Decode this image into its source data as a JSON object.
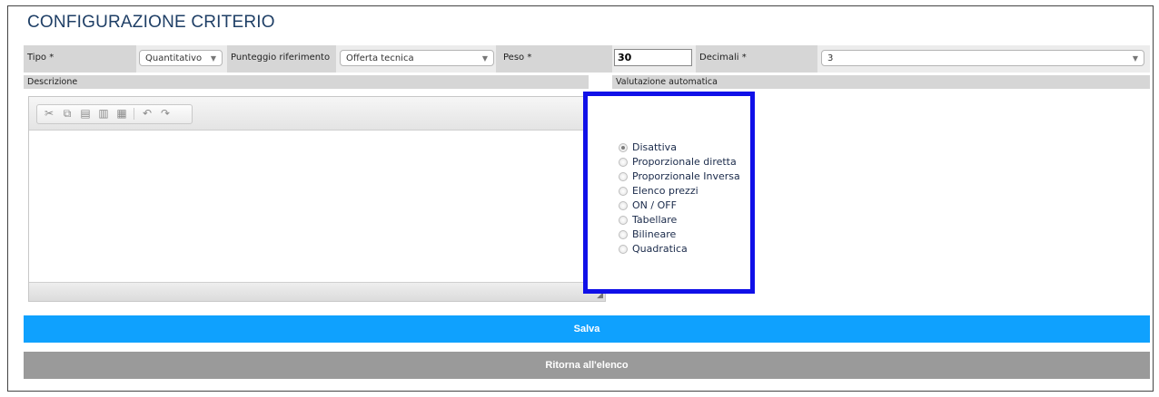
{
  "page": {
    "title": "CONFIGURAZIONE CRITERIO"
  },
  "form": {
    "tipo_label": "Tipo *",
    "tipo_value": "Quantitativo",
    "punteggio_label": "Punteggio riferimento *",
    "punteggio_value": "Offerta tecnica",
    "peso_label": "Peso *",
    "peso_value": "30",
    "decimali_label": "Decimali *",
    "decimali_value": "3",
    "descrizione_label": "Descrizione",
    "valutazione_label": "Valutazione automatica"
  },
  "editor": {
    "toolbar_icons": [
      "cut-icon",
      "copy-icon",
      "paste-icon",
      "paste-text-icon",
      "paste-word-icon",
      "undo-icon",
      "redo-icon"
    ]
  },
  "valutazione": {
    "options": [
      "Disattiva",
      "Proporzionale diretta",
      "Proporzionale Inversa",
      "Elenco prezzi",
      "ON / OFF",
      "Tabellare",
      "Bilineare",
      "Quadratica"
    ],
    "selected": "Disattiva"
  },
  "buttons": {
    "save": "Salva",
    "back": "Ritorna all'elenco"
  },
  "colors": {
    "save": "#0fa1fe",
    "back": "#9a9a9a",
    "highlight": "#1010e8",
    "title": "#1f3f66"
  }
}
